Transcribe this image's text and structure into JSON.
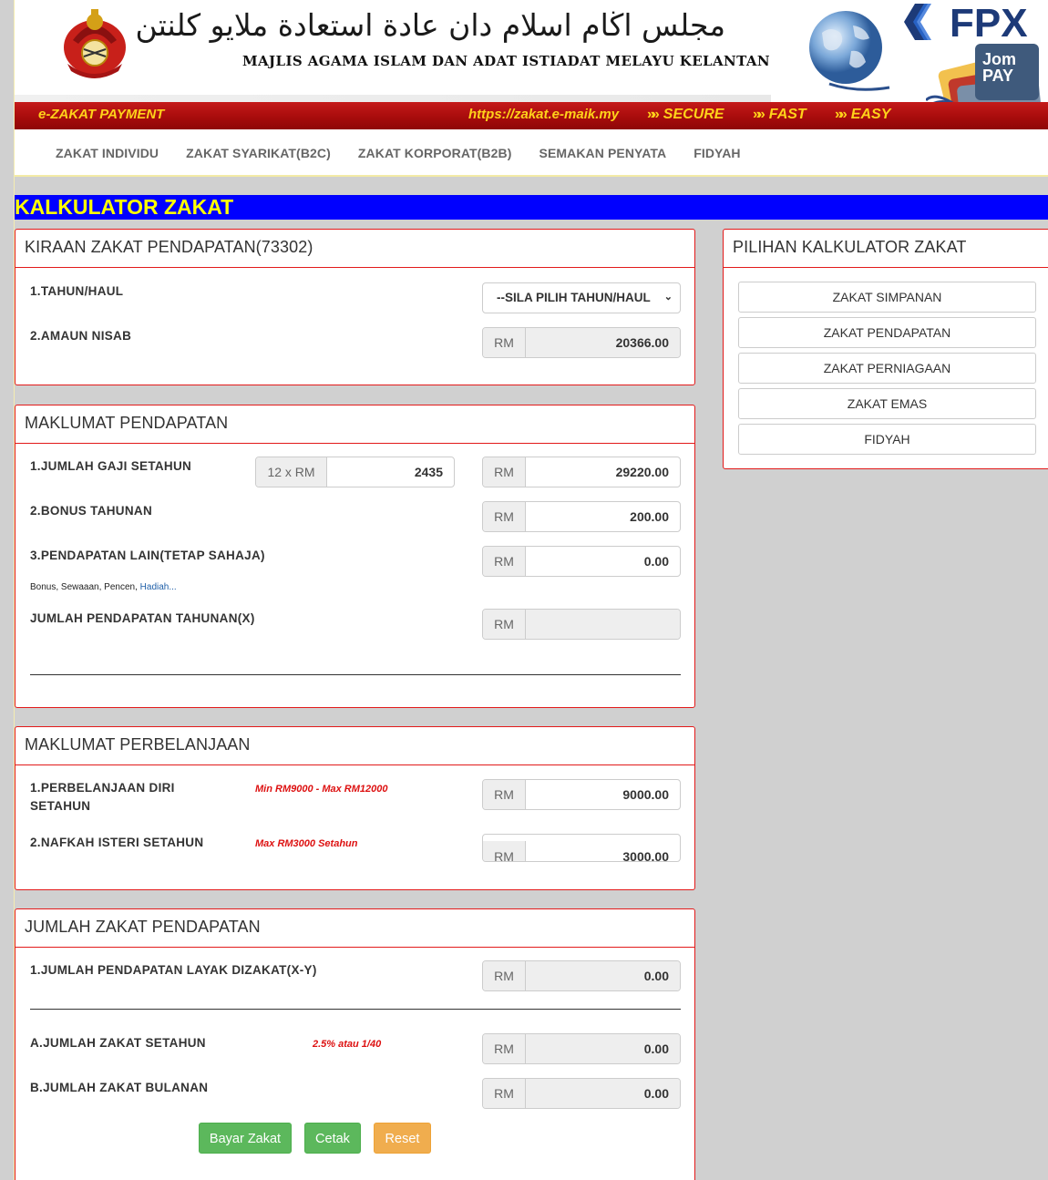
{
  "header": {
    "arabic_title": "مجلس اڬام اسلام دان عادة استعادة ملايو كلنتن",
    "org_name": "MAJLIS AGAMA ISLAM DAN ADAT ISTIADAT MELAYU KELANTAN",
    "payment_label": "e-ZAKAT PAYMENT",
    "url": "https://zakat.e-maik.my",
    "taglines": [
      "SECURE",
      "FAST",
      "EASY"
    ],
    "fpx_logo_text": "FPX",
    "jompay_line1": "Jom",
    "jompay_line2": "PAY"
  },
  "nav": {
    "items": [
      "ZAKAT INDIVIDU",
      "ZAKAT SYARIKAT(B2C)",
      "ZAKAT KORPORAT(B2B)",
      "SEMAKAN PENYATA",
      "FIDYAH"
    ]
  },
  "banner": {
    "title": "KALKULATOR ZAKAT"
  },
  "kiraan": {
    "title": "KIRAAN ZAKAT PENDAPATAN(73302)",
    "tahun_label": "1.TAHUN/HAUL",
    "tahun_select": "--SILA PILIH TAHUN/HAUL",
    "nisab_label": "2.AMAUN NISAB",
    "nisab_value": "20366.00"
  },
  "pendapatan": {
    "title": "MAKLUMAT PENDAPATAN",
    "gaji_label": "1.JUMLAH GAJI SETAHUN",
    "gaji_multiplier": "12 x RM",
    "gaji_monthly": "2435",
    "gaji_total": "29220.00",
    "bonus_label": "2.BONUS TAHUNAN",
    "bonus_value": "200.00",
    "lain_label": "3.PENDAPATAN LAIN(TETAP SAHAJA)",
    "lain_value": "0.00",
    "lain_note": "Bonus, Sewaaan, Pencen,",
    "lain_note_link": "Hadiah...",
    "jumlah_label": "JUMLAH PENDAPATAN TAHUNAN(X)",
    "jumlah_value": ""
  },
  "perbelanjaan": {
    "title": "MAKLUMAT PERBELANJAAN",
    "diri_label_1": "1.PERBELANJAAN DIRI",
    "diri_label_2": "SETAHUN",
    "diri_hint": "Min RM9000 - Max RM12000",
    "diri_value": "9000.00",
    "isteri_label": "2.NAFKAH ISTERI SETAHUN",
    "isteri_hint": "Max RM3000 Setahun",
    "isteri_value": "3000.00"
  },
  "jumlah_zakat": {
    "title": "JUMLAH ZAKAT PENDAPATAN",
    "layak_label": "1.JUMLAH PENDAPATAN LAYAK DIZAKAT(X-Y)",
    "layak_value": "0.00",
    "setahun_label": "A.JUMLAH ZAKAT SETAHUN",
    "rate_hint": "2.5% atau 1/40",
    "setahun_value": "0.00",
    "bulanan_label": "B.JUMLAH ZAKAT BULANAN",
    "bulanan_value": "0.00"
  },
  "currency": "RM",
  "actions": {
    "bayar": "Bayar Zakat",
    "cetak": "Cetak",
    "reset": "Reset"
  },
  "sidebar": {
    "title": "PILIHAN KALKULATOR ZAKAT",
    "options": [
      "ZAKAT SIMPANAN",
      "ZAKAT PENDAPATAN",
      "ZAKAT PERNIAGAAN",
      "ZAKAT EMAS",
      "FIDYAH"
    ]
  },
  "colors": {
    "brand_red": "#e21a1a",
    "banner_blue": "#0000ff",
    "banner_text": "#ffff00",
    "success": "#5cb85c",
    "warning": "#f0ad4e"
  }
}
